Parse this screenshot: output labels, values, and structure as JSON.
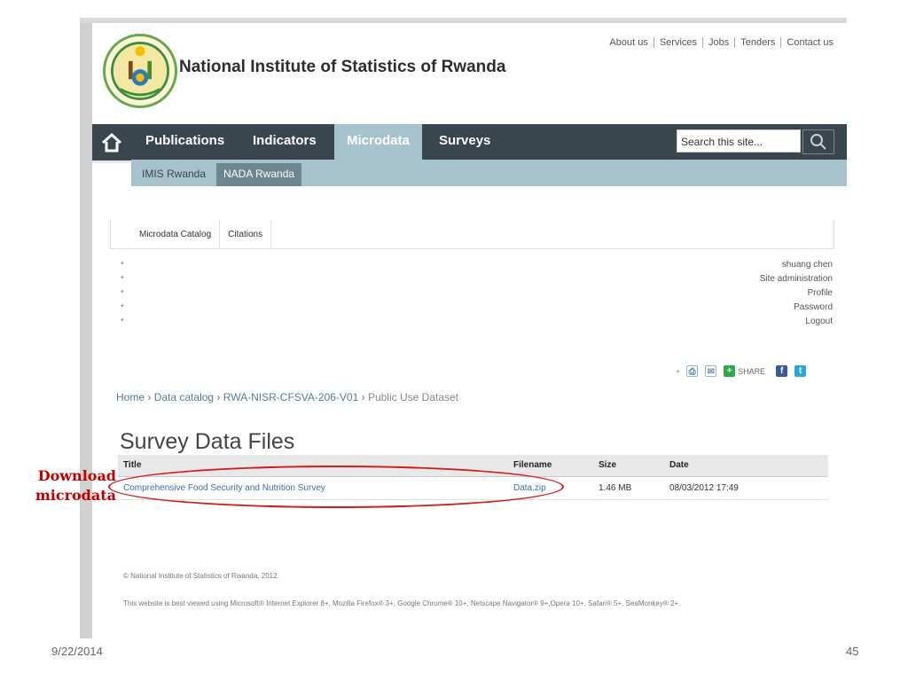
{
  "header": {
    "site_title": "National Institute of Statistics of Rwanda",
    "top_links": [
      "About us",
      "Services",
      "Jobs",
      "Tenders",
      "Contact us"
    ]
  },
  "nav": {
    "items": [
      "Publications",
      "Indicators",
      "Microdata",
      "Surveys"
    ],
    "active": "Microdata",
    "search_placeholder": "Search this site..."
  },
  "subnav": {
    "items": [
      "IMIS Rwanda",
      "NADA Rwanda"
    ],
    "active": "NADA Rwanda"
  },
  "catalog_tabs": [
    "Microdata Catalog",
    "Citations"
  ],
  "user_menu": [
    "shuang chen",
    "Site administration",
    "Profile",
    "Password",
    "Logout"
  ],
  "share": {
    "label": "SHARE"
  },
  "breadcrumb": {
    "items": [
      "Home",
      "Data catalog",
      "RWA-NISR-CFSVA-206-V01"
    ],
    "current": "Public Use Dataset"
  },
  "page_title": "Survey Data Files",
  "files_table": {
    "headers": [
      "Title",
      "Filename",
      "Size",
      "Date"
    ],
    "rows": [
      {
        "title": "Comprehensive Food Security and Nutrition Survey",
        "filename": "Data.zip",
        "size": "1.46 MB",
        "date": "08/03/2012 17:49"
      }
    ]
  },
  "annotation": {
    "line1": "Download",
    "line2": "microdata",
    "color": "#d21a1a"
  },
  "footer": {
    "copyright": "© National Institute of Statistics of Rwanda, 2012.",
    "note": "This website is best viewed using Microsoft® Internet Explorer 8+, Mozilla Firefox® 3+, Google Chrome® 10+, Netscape Navigator® 9+,Opera 10+, Safari® 5+, SeaMonkey® 2+."
  },
  "slide": {
    "date": "9/22/2014",
    "page_number": "45"
  },
  "colors": {
    "nav_bg": "#3a464d",
    "subnav_bg": "#a6c3cd",
    "active_sub": "#6e8690"
  }
}
